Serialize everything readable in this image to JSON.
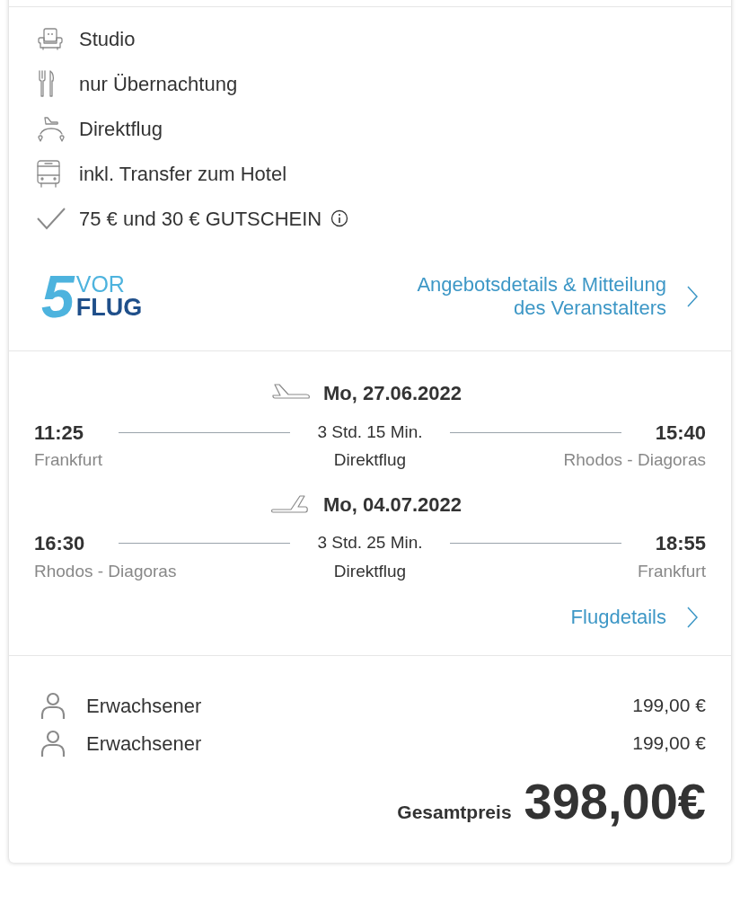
{
  "features": [
    {
      "kind": "room",
      "text": "Studio",
      "info": false
    },
    {
      "kind": "meal",
      "text": "nur Übernachtung",
      "info": false
    },
    {
      "kind": "flight",
      "text": "Direktflug",
      "info": false
    },
    {
      "kind": "transfer",
      "text": "inkl. Transfer zum Hotel",
      "info": false
    },
    {
      "kind": "check",
      "text": "75 € und 30 € GUTSCHEIN",
      "info": true
    }
  ],
  "operator": {
    "logo": {
      "digit": "5",
      "top": "VOR",
      "bottom": "FLUG"
    },
    "link": "Angebotsdetails & Mitteilung des Veranstalters"
  },
  "flights": [
    {
      "kind": "outbound",
      "date": "Mo, 27.06.2022",
      "departure_time": "11:25",
      "departure_place": "Frankfurt",
      "duration": "3 Std. 15 Min.",
      "type": "Direktflug",
      "arrival_time": "15:40",
      "arrival_place": "Rhodos - Diagoras"
    },
    {
      "kind": "return",
      "date": "Mo, 04.07.2022",
      "departure_time": "16:30",
      "departure_place": "Rhodos - Diagoras",
      "duration": "3 Std. 25 Min.",
      "type": "Direktflug",
      "arrival_time": "18:55",
      "arrival_place": "Frankfurt"
    }
  ],
  "flight_details_link": "Flugdetails",
  "travellers": [
    {
      "label": "Erwachsener",
      "price": "199,00 €"
    },
    {
      "label": "Erwachsener",
      "price": "199,00 €"
    }
  ],
  "total": {
    "label": "Gesamtpreis",
    "amount": "398,00€"
  }
}
